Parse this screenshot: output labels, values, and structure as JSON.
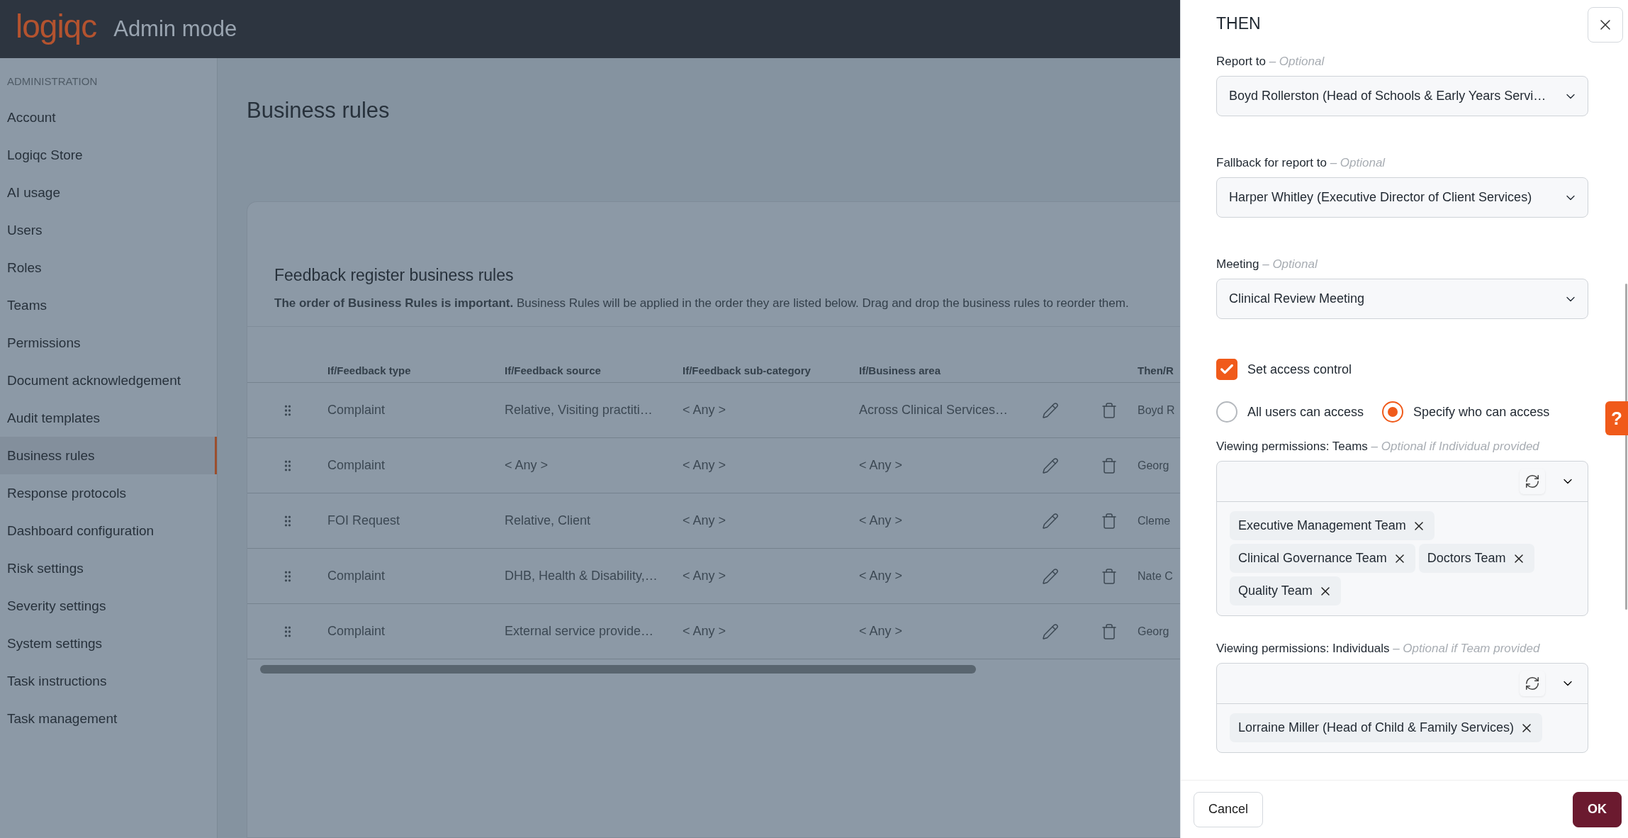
{
  "header": {
    "logo": "logiqc",
    "mode": "Admin mode"
  },
  "sidebar": {
    "section": "ADMINISTRATION",
    "items": [
      {
        "label": "Account",
        "selected": false
      },
      {
        "label": "Logiqc Store",
        "selected": false
      },
      {
        "label": "AI usage",
        "selected": false
      },
      {
        "label": "Users",
        "selected": false
      },
      {
        "label": "Roles",
        "selected": false
      },
      {
        "label": "Teams",
        "selected": false
      },
      {
        "label": "Permissions",
        "selected": false
      },
      {
        "label": "Document acknowledgement",
        "selected": false
      },
      {
        "label": "Audit templates",
        "selected": false
      },
      {
        "label": "Business rules",
        "selected": true
      },
      {
        "label": "Response protocols",
        "selected": false
      },
      {
        "label": "Dashboard configuration",
        "selected": false
      },
      {
        "label": "Risk settings",
        "selected": false
      },
      {
        "label": "Severity settings",
        "selected": false
      },
      {
        "label": "System settings",
        "selected": false
      },
      {
        "label": "Task instructions",
        "selected": false
      },
      {
        "label": "Task management",
        "selected": false
      }
    ]
  },
  "page_title": "Business rules",
  "card": {
    "title": "Feedback register business rules",
    "note": "**The order of Business Rules is important.** Business Rules will be applied in the order they are listed below. Drag and drop the business rules to reorder them.",
    "table": {
      "columns": [
        "If/Feedback type",
        "If/Feedback source",
        "If/Feedback sub-category",
        "If/Business area",
        "Then/R"
      ],
      "rows": [
        {
          "cells": [
            "Complaint",
            "Relative, Visiting practiti…",
            "< Any >",
            "Across Clinical Services…",
            "Boyd R"
          ]
        },
        {
          "cells": [
            "Complaint",
            "< Any >",
            "< Any >",
            "< Any >",
            "Georg"
          ]
        },
        {
          "cells": [
            "FOI Request",
            "Relative, Client",
            "< Any >",
            "< Any >",
            "Cleme"
          ]
        },
        {
          "cells": [
            "Complaint",
            "DHB, Health & Disability,…",
            "< Any >",
            "< Any >",
            "Nate C"
          ]
        },
        {
          "cells": [
            "Complaint",
            "External service provide…",
            "< Any >",
            "< Any >",
            "Georg"
          ]
        }
      ]
    }
  },
  "panel": {
    "title": "THEN",
    "fields": [
      {
        "kind": "select",
        "label": "Report to",
        "hint": "– Optional",
        "value": "Boyd Rollerston (Head of Schools & Early Years Servi…"
      },
      {
        "kind": "select",
        "label": "Fallback for report to",
        "hint": "– Optional",
        "value": "Harper Whitley (Executive Director of Client Services)"
      },
      {
        "kind": "select",
        "label": "Meeting",
        "hint": "– Optional",
        "value": "Clinical Review Meeting"
      },
      {
        "kind": "checkbox",
        "label": "Set access control",
        "checked": true
      },
      {
        "kind": "radio_group",
        "options": [
          {
            "label": "All users can access",
            "selected": false
          },
          {
            "label": "Specify who can access",
            "selected": true
          }
        ]
      },
      {
        "kind": "multiselect",
        "label": "Viewing permissions: Teams",
        "hint": "– Optional if Individual provided",
        "tags": [
          "Executive Management Team",
          "Clinical Governance Team",
          "Doctors Team",
          "Quality Team"
        ]
      },
      {
        "kind": "multiselect",
        "label": "Viewing permissions: Individuals",
        "hint": "– Optional if Team provided",
        "tags": [
          "Lorraine Miller (Head of Child & Family Services)"
        ]
      }
    ],
    "buttons": [
      {
        "label": "Cancel",
        "kind": "secondary"
      },
      {
        "label": "OK",
        "kind": "primary"
      }
    ]
  },
  "help_tab": "?"
}
